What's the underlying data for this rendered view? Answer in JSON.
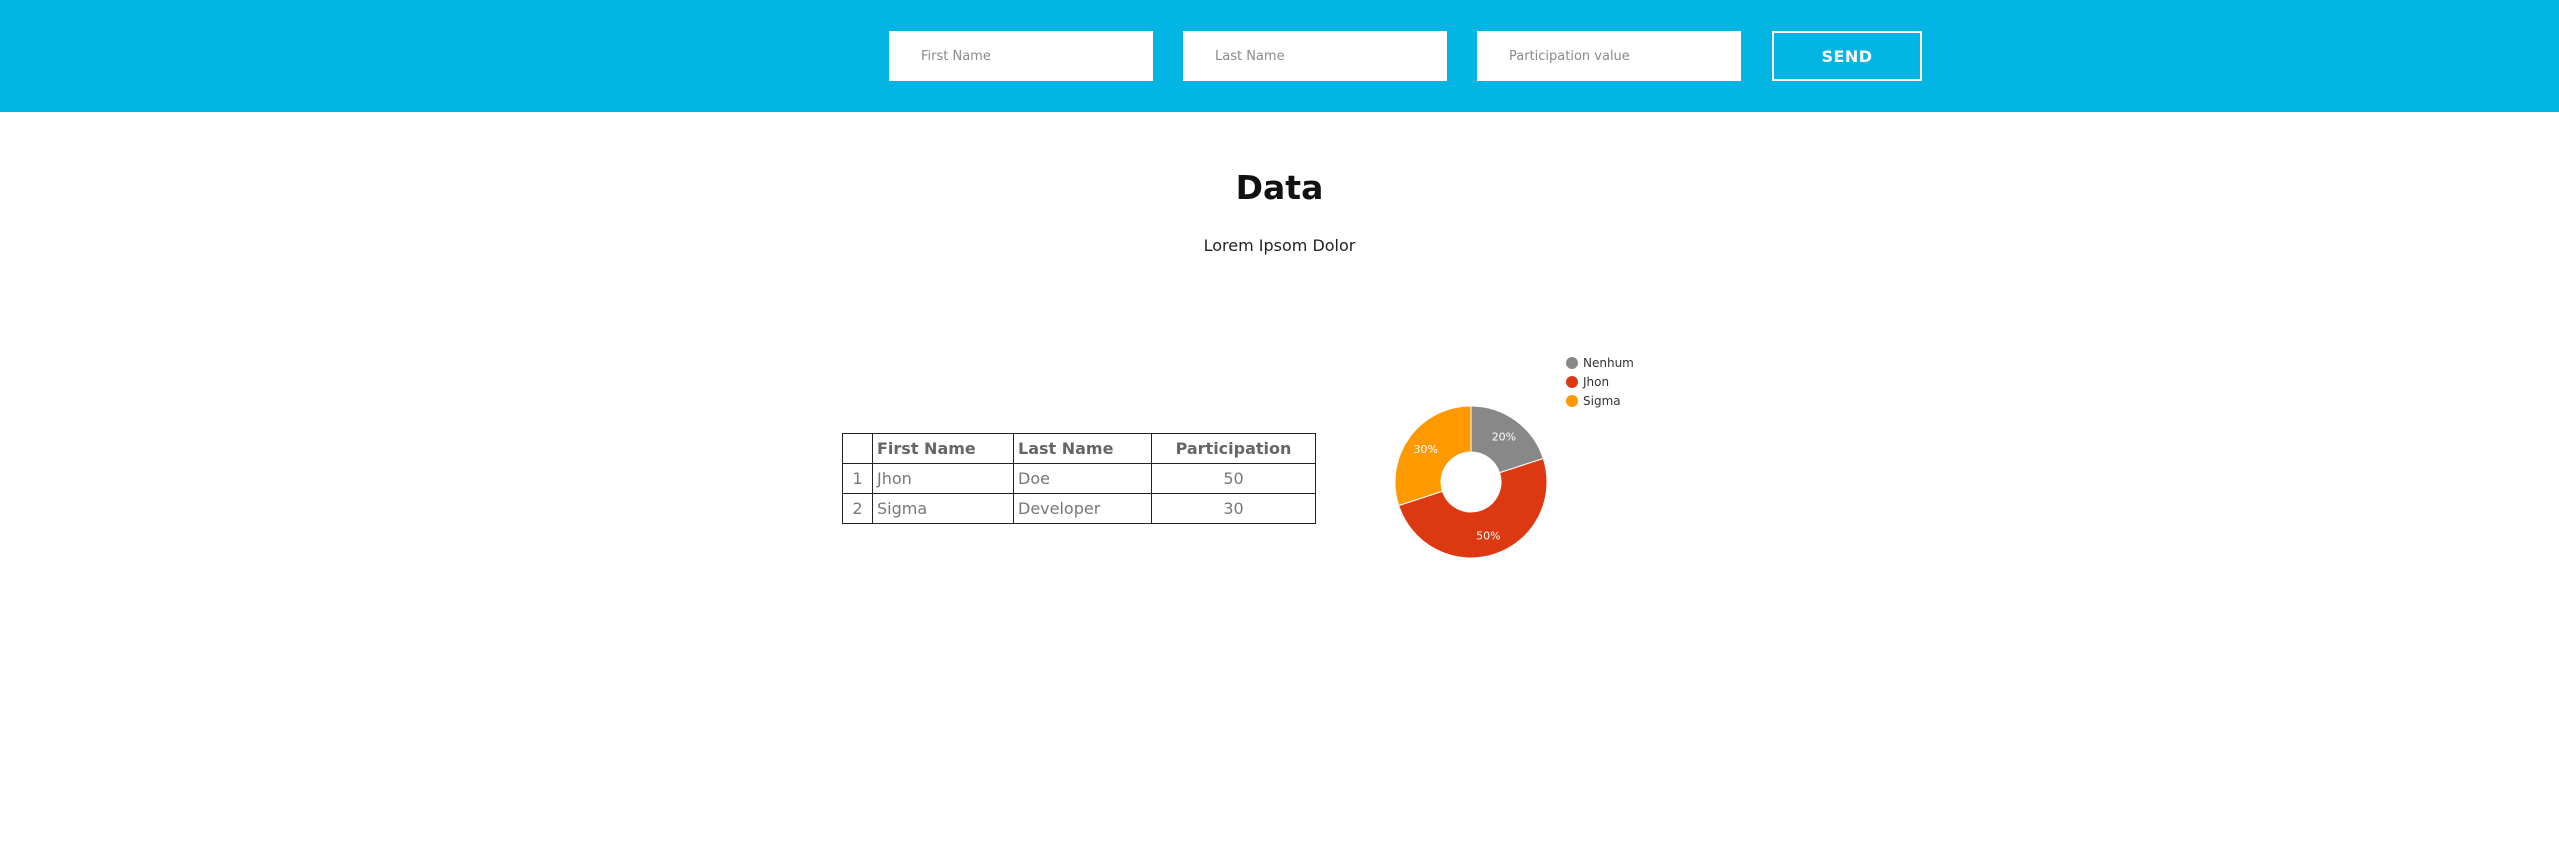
{
  "form": {
    "first_name_placeholder": "First Name",
    "last_name_placeholder": "Last Name",
    "participation_placeholder": "Participation value",
    "send_label": "SEND"
  },
  "header": {
    "title": "Data",
    "subtitle": "Lorem Ipsom Dolor"
  },
  "table": {
    "columns": [
      "",
      "First Name",
      "Last Name",
      "Participation"
    ],
    "rows": [
      {
        "index": "1",
        "first": "Jhon",
        "last": "Doe",
        "participation": "50"
      },
      {
        "index": "2",
        "first": "Sigma",
        "last": "Developer",
        "participation": "30"
      }
    ]
  },
  "chart_data": {
    "type": "pie",
    "categories": [
      "Nenhum",
      "Jhon",
      "Sigma"
    ],
    "values": [
      20,
      50,
      30
    ],
    "labels": [
      "20%",
      "50%",
      "30%"
    ],
    "colors": [
      "#888888",
      "#dc3912",
      "#ff9900"
    ],
    "legend": "top-right"
  }
}
